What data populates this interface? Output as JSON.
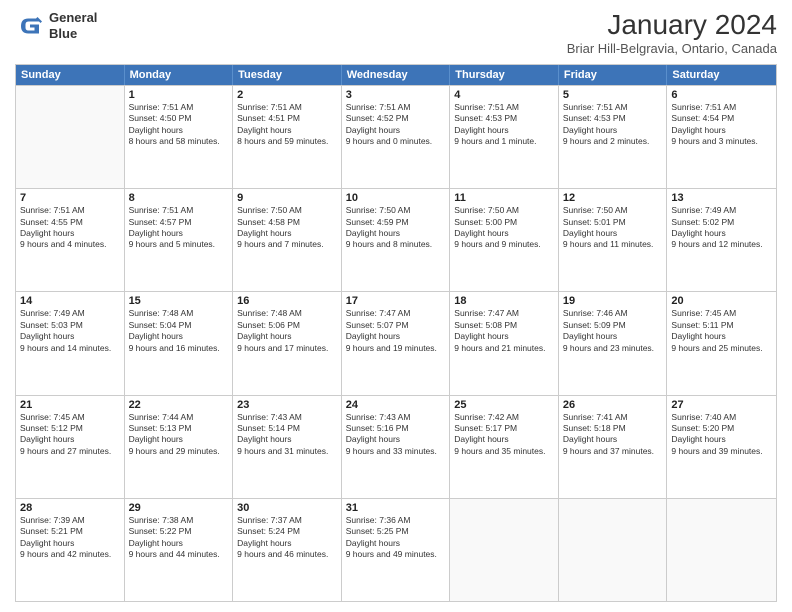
{
  "header": {
    "logo_line1": "General",
    "logo_line2": "Blue",
    "main_title": "January 2024",
    "subtitle": "Briar Hill-Belgravia, Ontario, Canada"
  },
  "days_of_week": [
    "Sunday",
    "Monday",
    "Tuesday",
    "Wednesday",
    "Thursday",
    "Friday",
    "Saturday"
  ],
  "weeks": [
    [
      {
        "day": "",
        "empty": true
      },
      {
        "day": "1",
        "sunrise": "7:51 AM",
        "sunset": "4:50 PM",
        "daylight": "8 hours and 58 minutes."
      },
      {
        "day": "2",
        "sunrise": "7:51 AM",
        "sunset": "4:51 PM",
        "daylight": "8 hours and 59 minutes."
      },
      {
        "day": "3",
        "sunrise": "7:51 AM",
        "sunset": "4:52 PM",
        "daylight": "9 hours and 0 minutes."
      },
      {
        "day": "4",
        "sunrise": "7:51 AM",
        "sunset": "4:53 PM",
        "daylight": "9 hours and 1 minute."
      },
      {
        "day": "5",
        "sunrise": "7:51 AM",
        "sunset": "4:53 PM",
        "daylight": "9 hours and 2 minutes."
      },
      {
        "day": "6",
        "sunrise": "7:51 AM",
        "sunset": "4:54 PM",
        "daylight": "9 hours and 3 minutes."
      }
    ],
    [
      {
        "day": "7",
        "sunrise": "7:51 AM",
        "sunset": "4:55 PM",
        "daylight": "9 hours and 4 minutes."
      },
      {
        "day": "8",
        "sunrise": "7:51 AM",
        "sunset": "4:57 PM",
        "daylight": "9 hours and 5 minutes."
      },
      {
        "day": "9",
        "sunrise": "7:50 AM",
        "sunset": "4:58 PM",
        "daylight": "9 hours and 7 minutes."
      },
      {
        "day": "10",
        "sunrise": "7:50 AM",
        "sunset": "4:59 PM",
        "daylight": "9 hours and 8 minutes."
      },
      {
        "day": "11",
        "sunrise": "7:50 AM",
        "sunset": "5:00 PM",
        "daylight": "9 hours and 9 minutes."
      },
      {
        "day": "12",
        "sunrise": "7:50 AM",
        "sunset": "5:01 PM",
        "daylight": "9 hours and 11 minutes."
      },
      {
        "day": "13",
        "sunrise": "7:49 AM",
        "sunset": "5:02 PM",
        "daylight": "9 hours and 12 minutes."
      }
    ],
    [
      {
        "day": "14",
        "sunrise": "7:49 AM",
        "sunset": "5:03 PM",
        "daylight": "9 hours and 14 minutes."
      },
      {
        "day": "15",
        "sunrise": "7:48 AM",
        "sunset": "5:04 PM",
        "daylight": "9 hours and 16 minutes."
      },
      {
        "day": "16",
        "sunrise": "7:48 AM",
        "sunset": "5:06 PM",
        "daylight": "9 hours and 17 minutes."
      },
      {
        "day": "17",
        "sunrise": "7:47 AM",
        "sunset": "5:07 PM",
        "daylight": "9 hours and 19 minutes."
      },
      {
        "day": "18",
        "sunrise": "7:47 AM",
        "sunset": "5:08 PM",
        "daylight": "9 hours and 21 minutes."
      },
      {
        "day": "19",
        "sunrise": "7:46 AM",
        "sunset": "5:09 PM",
        "daylight": "9 hours and 23 minutes."
      },
      {
        "day": "20",
        "sunrise": "7:45 AM",
        "sunset": "5:11 PM",
        "daylight": "9 hours and 25 minutes."
      }
    ],
    [
      {
        "day": "21",
        "sunrise": "7:45 AM",
        "sunset": "5:12 PM",
        "daylight": "9 hours and 27 minutes."
      },
      {
        "day": "22",
        "sunrise": "7:44 AM",
        "sunset": "5:13 PM",
        "daylight": "9 hours and 29 minutes."
      },
      {
        "day": "23",
        "sunrise": "7:43 AM",
        "sunset": "5:14 PM",
        "daylight": "9 hours and 31 minutes."
      },
      {
        "day": "24",
        "sunrise": "7:43 AM",
        "sunset": "5:16 PM",
        "daylight": "9 hours and 33 minutes."
      },
      {
        "day": "25",
        "sunrise": "7:42 AM",
        "sunset": "5:17 PM",
        "daylight": "9 hours and 35 minutes."
      },
      {
        "day": "26",
        "sunrise": "7:41 AM",
        "sunset": "5:18 PM",
        "daylight": "9 hours and 37 minutes."
      },
      {
        "day": "27",
        "sunrise": "7:40 AM",
        "sunset": "5:20 PM",
        "daylight": "9 hours and 39 minutes."
      }
    ],
    [
      {
        "day": "28",
        "sunrise": "7:39 AM",
        "sunset": "5:21 PM",
        "daylight": "9 hours and 42 minutes."
      },
      {
        "day": "29",
        "sunrise": "7:38 AM",
        "sunset": "5:22 PM",
        "daylight": "9 hours and 44 minutes."
      },
      {
        "day": "30",
        "sunrise": "7:37 AM",
        "sunset": "5:24 PM",
        "daylight": "9 hours and 46 minutes."
      },
      {
        "day": "31",
        "sunrise": "7:36 AM",
        "sunset": "5:25 PM",
        "daylight": "9 hours and 49 minutes."
      },
      {
        "day": "",
        "empty": true
      },
      {
        "day": "",
        "empty": true
      },
      {
        "day": "",
        "empty": true
      }
    ]
  ]
}
